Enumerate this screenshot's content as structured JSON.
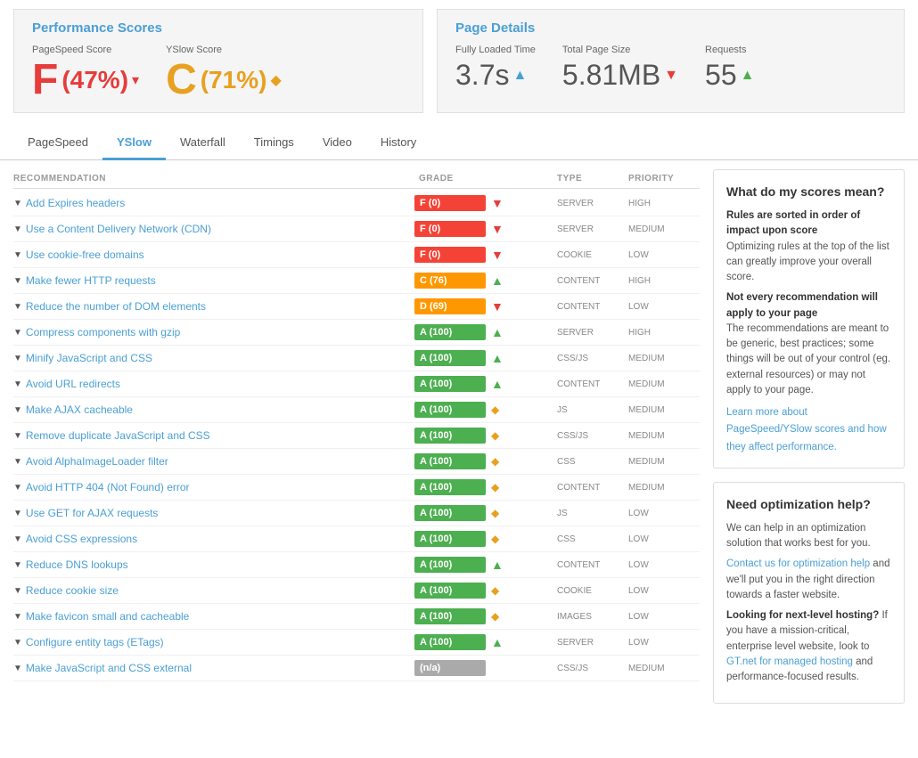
{
  "header": {
    "perf_title": "Performance Scores",
    "page_title": "Page Details",
    "pagespeed_label": "PageSpeed Score",
    "yslow_label": "YSlow Score",
    "pagespeed_value": "F(47%)",
    "yslow_value": "C(71%)",
    "loaded_label": "Fully Loaded Time",
    "loaded_value": "3.7s",
    "size_label": "Total Page Size",
    "size_value": "5.81MB",
    "requests_label": "Requests",
    "requests_value": "55"
  },
  "tabs": [
    "PageSpeed",
    "YSlow",
    "Waterfall",
    "Timings",
    "Video",
    "History"
  ],
  "active_tab": "YSlow",
  "table": {
    "headers": [
      "RECOMMENDATION",
      "GRADE",
      "TYPE",
      "PRIORITY"
    ],
    "rows": [
      {
        "name": "Add Expires headers",
        "grade": "F (0)",
        "grade_class": "grade-red",
        "icon": "down-red",
        "type": "SERVER",
        "priority": "HIGH"
      },
      {
        "name": "Use a Content Delivery Network (CDN)",
        "grade": "F (0)",
        "grade_class": "grade-red",
        "icon": "down-red",
        "type": "SERVER",
        "priority": "MEDIUM"
      },
      {
        "name": "Use cookie-free domains",
        "grade": "F (0)",
        "grade_class": "grade-red",
        "icon": "down-red",
        "type": "COOKIE",
        "priority": "LOW"
      },
      {
        "name": "Make fewer HTTP requests",
        "grade": "C (76)",
        "grade_class": "grade-orange",
        "icon": "up-green",
        "type": "CONTENT",
        "priority": "HIGH"
      },
      {
        "name": "Reduce the number of DOM elements",
        "grade": "D (69)",
        "grade_class": "grade-orange",
        "icon": "down-red",
        "type": "CONTENT",
        "priority": "LOW"
      },
      {
        "name": "Compress components with gzip",
        "grade": "A (100)",
        "grade_class": "grade-green",
        "icon": "up-green",
        "type": "SERVER",
        "priority": "HIGH"
      },
      {
        "name": "Minify JavaScript and CSS",
        "grade": "A (100)",
        "grade_class": "grade-green",
        "icon": "up-green",
        "type": "CSS/JS",
        "priority": "MEDIUM"
      },
      {
        "name": "Avoid URL redirects",
        "grade": "A (100)",
        "grade_class": "grade-green",
        "icon": "up-green",
        "type": "CONTENT",
        "priority": "MEDIUM"
      },
      {
        "name": "Make AJAX cacheable",
        "grade": "A (100)",
        "grade_class": "grade-green",
        "icon": "diamond-orange",
        "type": "JS",
        "priority": "MEDIUM"
      },
      {
        "name": "Remove duplicate JavaScript and CSS",
        "grade": "A (100)",
        "grade_class": "grade-green",
        "icon": "diamond-orange",
        "type": "CSS/JS",
        "priority": "MEDIUM"
      },
      {
        "name": "Avoid AlphaImageLoader filter",
        "grade": "A (100)",
        "grade_class": "grade-green",
        "icon": "diamond-orange",
        "type": "CSS",
        "priority": "MEDIUM"
      },
      {
        "name": "Avoid HTTP 404 (Not Found) error",
        "grade": "A (100)",
        "grade_class": "grade-green",
        "icon": "diamond-orange",
        "type": "CONTENT",
        "priority": "MEDIUM"
      },
      {
        "name": "Use GET for AJAX requests",
        "grade": "A (100)",
        "grade_class": "grade-green",
        "icon": "diamond-orange",
        "type": "JS",
        "priority": "LOW"
      },
      {
        "name": "Avoid CSS expressions",
        "grade": "A (100)",
        "grade_class": "grade-green",
        "icon": "diamond-orange",
        "type": "CSS",
        "priority": "LOW"
      },
      {
        "name": "Reduce DNS lookups",
        "grade": "A (100)",
        "grade_class": "grade-green",
        "icon": "up-green",
        "type": "CONTENT",
        "priority": "LOW"
      },
      {
        "name": "Reduce cookie size",
        "grade": "A (100)",
        "grade_class": "grade-green",
        "icon": "diamond-orange",
        "type": "COOKIE",
        "priority": "LOW"
      },
      {
        "name": "Make favicon small and cacheable",
        "grade": "A (100)",
        "grade_class": "grade-green",
        "icon": "diamond-orange",
        "type": "IMAGES",
        "priority": "LOW"
      },
      {
        "name": "Configure entity tags (ETags)",
        "grade": "A (100)",
        "grade_class": "grade-green",
        "icon": "up-green",
        "type": "SERVER",
        "priority": "LOW"
      },
      {
        "name": "Make JavaScript and CSS external",
        "grade": "(n/a)",
        "grade_class": "grade-gray",
        "icon": "none",
        "type": "CSS/JS",
        "priority": "MEDIUM"
      }
    ]
  },
  "sidebar": {
    "box1_title": "What do my scores mean?",
    "box1_p1_bold": "Rules are sorted in order of impact upon score",
    "box1_p1": "Optimizing rules at the top of the list can greatly improve your overall score.",
    "box1_p2_bold": "Not every recommendation will apply to your page",
    "box1_p2": "The recommendations are meant to be generic, best practices; some things will be out of your control (eg. external resources) or may not apply to your page.",
    "box1_link": "Learn more about PageSpeed/YSlow scores and how they affect performance.",
    "box2_title": "Need optimization help?",
    "box2_p1": "We can help in an optimization solution that works best for you.",
    "box2_link1": "Contact us for optimization help",
    "box2_p2": " and we'll put you in the right direction towards a faster website.",
    "box2_p3_bold": "Looking for next-level hosting?",
    "box2_p3": " If you have a mission-critical, enterprise level website, look to ",
    "box2_link2": "GT.net for managed hosting",
    "box2_p4": " and performance-focused results."
  }
}
